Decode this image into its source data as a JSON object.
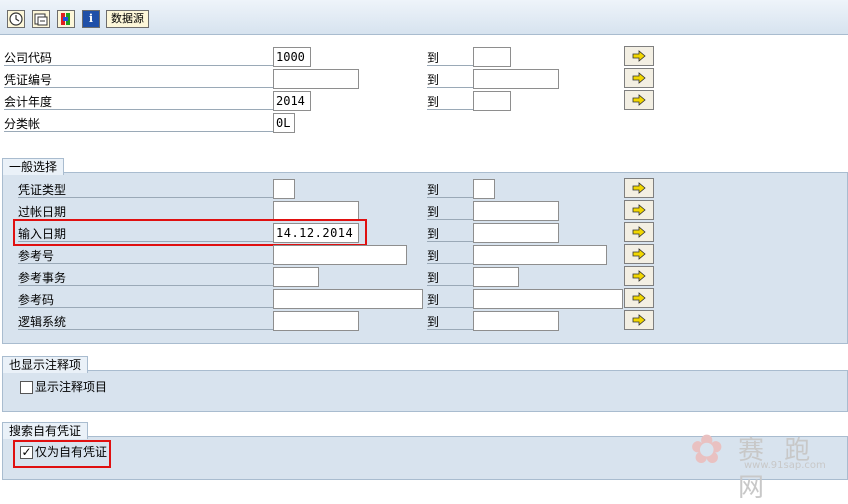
{
  "toolbar": {
    "buttons": [
      {
        "icon": "execute-icon"
      },
      {
        "icon": "variant-icon"
      },
      {
        "icon": "selection-options-icon"
      },
      {
        "icon": "info-icon"
      }
    ],
    "data_source_label": "数据源",
    "info_glyph": "i"
  },
  "to_label": "到",
  "header": {
    "rows": [
      {
        "label": "公司代码",
        "from": "1000"
      },
      {
        "label": "凭证编号",
        "from": ""
      },
      {
        "label": "会计年度",
        "from": "2014"
      },
      {
        "label": "分类帐",
        "from": "0L"
      }
    ]
  },
  "general": {
    "title": "一般选择",
    "rows": [
      {
        "label": "凭证类型",
        "from": ""
      },
      {
        "label": "过帐日期",
        "from": ""
      },
      {
        "label": "输入日期",
        "from": "14.12.2014"
      },
      {
        "label": "参考号",
        "from": ""
      },
      {
        "label": "参考事务",
        "from": ""
      },
      {
        "label": "参考码",
        "from": ""
      },
      {
        "label": "逻辑系统",
        "from": ""
      }
    ]
  },
  "display": {
    "title": "也显示注释项",
    "checkbox_label": "显示注释项目",
    "checked": false
  },
  "search": {
    "title": "搜索自有凭证",
    "checkbox_label": "仅为自有凭证",
    "checked": true,
    "check_glyph": "✓"
  },
  "watermark": {
    "name": "赛 跑 网",
    "url": "www.91sap.com"
  },
  "colors": {
    "highlight": "#e01010",
    "group_bg": "#d8e3ee",
    "button_arrow": "#f2d700"
  }
}
